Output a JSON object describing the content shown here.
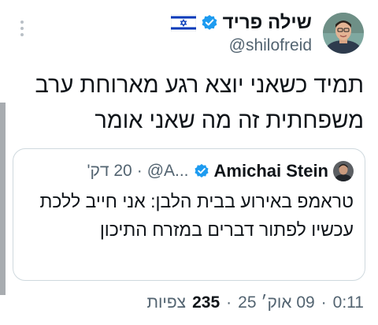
{
  "colors": {
    "verified": "#1d9bf0",
    "text": "#0f1419",
    "secondary": "#536471",
    "border": "#cfd9de"
  },
  "author": {
    "display_name": "שילה פריד",
    "handle": "@shilofreid",
    "verified_icon": "verified-badge-icon",
    "flag_icon": "israel-flag-icon"
  },
  "tweet": {
    "text": "תמיד כשאני יוצא רגע מארוחת ערב משפחתית זה מה שאני אומר"
  },
  "quote": {
    "display_name": "Amichai Stein",
    "handle": "@A...",
    "separator": "·",
    "time": "20 דק'",
    "text": "טראמפ באירוע בבית הלבן: אני חייב ללכת עכשיו לפתור דברים במזרח התיכון"
  },
  "footer": {
    "time": "0:11",
    "sep1": "·",
    "date": "09 אוק׳ 25",
    "sep2": "·",
    "views_count": "235",
    "views_label": "צפיות"
  },
  "icons": {
    "more": "more-vertical-icon"
  }
}
